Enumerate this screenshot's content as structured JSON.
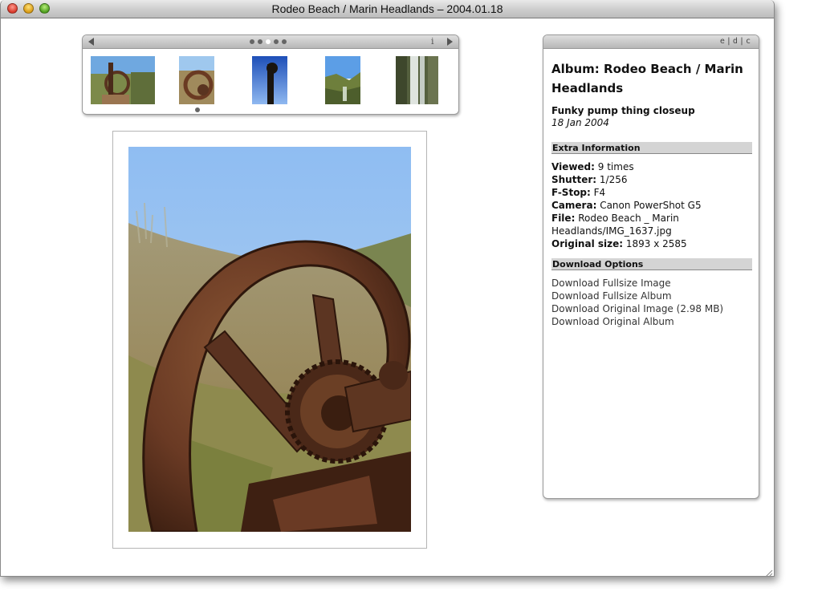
{
  "window": {
    "title": "Rodeo Beach / Marin Headlands – 2004.01.18"
  },
  "filmstrip": {
    "info_label": "i",
    "page_count": 5,
    "active_page": 3
  },
  "info_panel": {
    "bar_label": "e|d|c",
    "album_title": "Album: Rodeo Beach / Marin Headlands",
    "photo_title": "Funky pump thing closeup",
    "photo_date": "18 Jan 2004",
    "extra_heading": "Extra Information",
    "fields": [
      {
        "label": "Viewed:",
        "value": "9 times"
      },
      {
        "label": "Shutter:",
        "value": "1/256"
      },
      {
        "label": "F-Stop:",
        "value": "F4"
      },
      {
        "label": "Camera:",
        "value": "Canon PowerShot G5"
      },
      {
        "label": "File:",
        "value": "Rodeo Beach _ Marin Headlands/IMG_1637.jpg"
      },
      {
        "label": "Original size:",
        "value": "1893 x 2585"
      }
    ],
    "download_heading": "Download Options",
    "downloads": [
      "Download Fullsize Image",
      "Download Fullsize Album",
      "Download Original Image (2.98 MB)",
      "Download Original Album"
    ]
  }
}
